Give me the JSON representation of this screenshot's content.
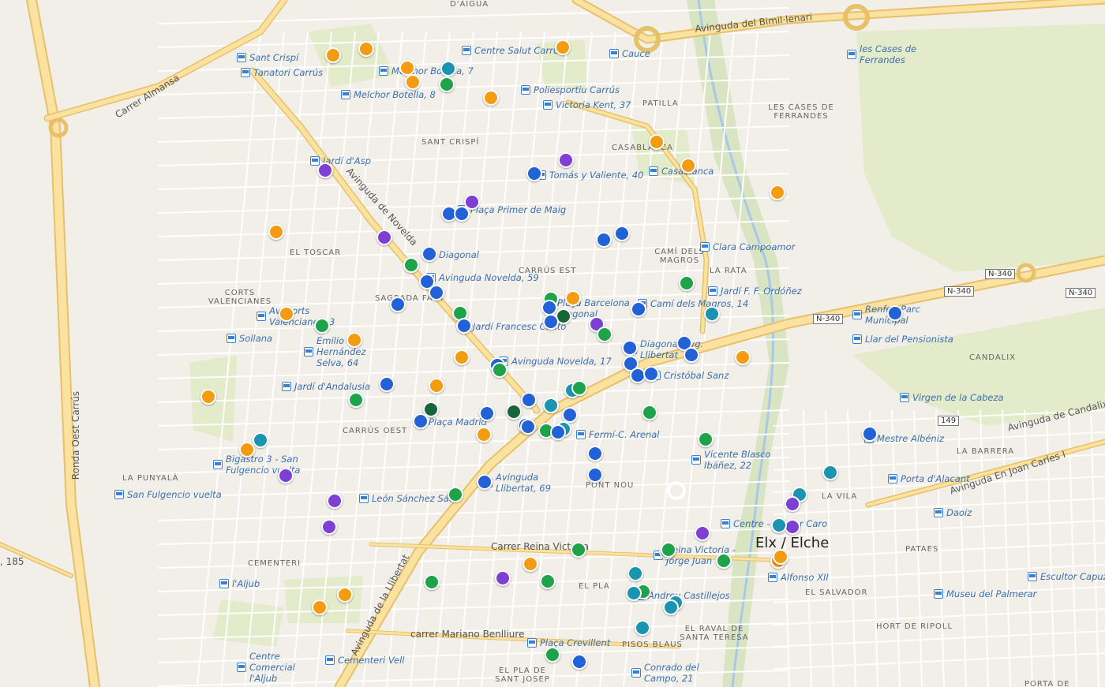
{
  "map": {
    "place_name": "Elx / Elche",
    "colors": {
      "land": "#f2efe9",
      "park": "#e3ebcb",
      "major_road": "#fbe2a0",
      "major_road_edge": "#e7c16a",
      "minor_road": "#ffffff",
      "water": "#a8c8e8",
      "orange": "#f39c12",
      "blue": "#2262d6",
      "purple": "#7e3fd4",
      "green": "#1fa34a",
      "dark_green": "#17663a",
      "teal": "#1a94b0"
    },
    "street_labels": [
      {
        "id": "carrer-almansa",
        "text": "Carrer Almansa"
      },
      {
        "id": "avinguda-novelda",
        "text": "Avinguda de Novelda"
      },
      {
        "id": "ronda-oest-carrus",
        "text": "Ronda Oest Carrús"
      },
      {
        "id": "avinguda-llibertat",
        "text": "Avinguda de la Llibertat"
      },
      {
        "id": "carrer-reina-victoria",
        "text": "Carrer Reina Victoria"
      },
      {
        "id": "carrer-mariano-benlliure",
        "text": "carrer Mariano Benlliure"
      },
      {
        "id": "avinguda-bimil-lenari",
        "text": "Avinguda del Bimil·lenari"
      },
      {
        "id": "avinguda-candalix",
        "text": "Avinguda de Candalix"
      },
      {
        "id": "avinguda-joan-carles",
        "text": "Avinguda En Joan Carles I"
      },
      {
        "id": "road-185",
        "text": ", 185"
      }
    ],
    "districts": [
      {
        "id": "d-aigua",
        "text": "D'AIGUA"
      },
      {
        "id": "sant-crispi",
        "text": "SANT CRISPÍ"
      },
      {
        "id": "patilla",
        "text": "PATILLA"
      },
      {
        "id": "les-cases",
        "text": "LES CASES DE FERRANDES"
      },
      {
        "id": "casablanca",
        "text": "CASABLANCA"
      },
      {
        "id": "el-toscar",
        "text": "EL TOSCAR"
      },
      {
        "id": "cami-magros",
        "text": "CAMÍ DELS MAGROS"
      },
      {
        "id": "la-rata",
        "text": "LA RATA"
      },
      {
        "id": "carrus-est",
        "text": "CARRÚS EST"
      },
      {
        "id": "corts-valencianes",
        "text": "CORTS VALENCIANES"
      },
      {
        "id": "sagrada-familia",
        "text": "SAGRADA FAMÍ"
      },
      {
        "id": "carrus-oest",
        "text": "CARRÚS OEST"
      },
      {
        "id": "la-punyala",
        "text": "LA PUNYALÀ"
      },
      {
        "id": "cementeri",
        "text": "CEMENTERI"
      },
      {
        "id": "candalix",
        "text": "CANDALIX"
      },
      {
        "id": "la-barrera",
        "text": "LA BARRERA"
      },
      {
        "id": "la-vila",
        "text": "LA VILA"
      },
      {
        "id": "pont-nou",
        "text": "PONT NOU"
      },
      {
        "id": "el-pla",
        "text": "EL PLA"
      },
      {
        "id": "pisos-blaus",
        "text": "PISOS BLAUS"
      },
      {
        "id": "raval",
        "text": "EL RAVAL DE SANTA TERESA"
      },
      {
        "id": "el-salvador",
        "text": "EL SALVADOR"
      },
      {
        "id": "hort-de-ripoll",
        "text": "HORT DE RIPOLL"
      },
      {
        "id": "pataes",
        "text": "PATAES"
      },
      {
        "id": "el-pla-sant-josep",
        "text": "EL PLA DE SANT JOSEP"
      },
      {
        "id": "porta-de",
        "text": "PORTA DE"
      }
    ],
    "shields": [
      {
        "id": "n340-a",
        "text": "N-340"
      },
      {
        "id": "n340-b",
        "text": "N-340"
      },
      {
        "id": "n340-c",
        "text": "N-340"
      },
      {
        "id": "n340-d",
        "text": "N-340"
      },
      {
        "id": "r149",
        "text": "149"
      }
    ],
    "bus_stops": [
      {
        "id": "sant-crispi",
        "text": "Sant Crispí"
      },
      {
        "id": "tanatori-carrus",
        "text": "Tanatori Carrús"
      },
      {
        "id": "melchor-botella-7",
        "text": "Melchor Botella, 7"
      },
      {
        "id": "melchor-botella-8",
        "text": "Melchor Botella, 8"
      },
      {
        "id": "centre-salut-carrus",
        "text": "Centre Salut Carrús"
      },
      {
        "id": "cauce",
        "text": "Cauce"
      },
      {
        "id": "les-cases-ferrandes",
        "text": "les Cases de Ferrandes"
      },
      {
        "id": "poliesportiu-carrus",
        "text": "Poliesportiu Carrús"
      },
      {
        "id": "victoria-kent",
        "text": "Victoria Kent, 37"
      },
      {
        "id": "jardi-asp",
        "text": "Jardí d'Asp"
      },
      {
        "id": "tomas-valiente",
        "text": "Tomás y Valiente, 40"
      },
      {
        "id": "casablanca",
        "text": "Casablanca"
      },
      {
        "id": "placa-primer-maig",
        "text": "Plaça Primer de Maig"
      },
      {
        "id": "clara-campoamor",
        "text": "Clara Campoamor"
      },
      {
        "id": "diagonal",
        "text": "Diagonal"
      },
      {
        "id": "avinguda-novelda-59",
        "text": "Avinguda Novelda, 59"
      },
      {
        "id": "jardi-ordonez",
        "text": "Jardí F. F. Ordóñez"
      },
      {
        "id": "placa-barcelona",
        "text": "Plaça Barcelona Diagonal"
      },
      {
        "id": "cami-magros-14",
        "text": "Camí dels Magros, 14"
      },
      {
        "id": "renfe-parc",
        "text": "Renfe - Parc Municipal"
      },
      {
        "id": "avcorts",
        "text": "Av. Corts Valencianes, 3"
      },
      {
        "id": "jardi-francesc",
        "text": "Jardí Francesc Cantó"
      },
      {
        "id": "llar-pensionista",
        "text": "Llar del Pensionista"
      },
      {
        "id": "emilio-hernandez",
        "text": "Emilio Hernández Selva, 64"
      },
      {
        "id": "sollana",
        "text": "Sollana"
      },
      {
        "id": "diagonal-libertat",
        "text": "Diagonal Avg. Llibertat"
      },
      {
        "id": "avinguda-novelda-17",
        "text": "Avinguda Novelda, 17"
      },
      {
        "id": "cristobal-sanz",
        "text": "Cristóbal Sanz"
      },
      {
        "id": "jardi-andalusia",
        "text": "Jardí d'Andalusia"
      },
      {
        "id": "virgen-cabeza",
        "text": "Virgen de la Cabeza"
      },
      {
        "id": "placa-madrid",
        "text": "Plaça Madrid"
      },
      {
        "id": "fermi-arenal",
        "text": "Fermí-C. Arenal"
      },
      {
        "id": "mestre-albeniz",
        "text": "Mestre Albéniz"
      },
      {
        "id": "vicente-blasco",
        "text": "Vicente Blasco Ibáñez, 22"
      },
      {
        "id": "bigastro",
        "text": "Bigastro 3 - San Fulgencio vuelta"
      },
      {
        "id": "porta-alacant",
        "text": "Porta d'Alacant"
      },
      {
        "id": "avinguda-llibertat-69",
        "text": "Avinguda Llibertat, 69"
      },
      {
        "id": "san-fulgencio",
        "text": "San Fulgencio vuelta"
      },
      {
        "id": "leon-sanchez",
        "text": "León Sánchez Sáez"
      },
      {
        "id": "daoiz",
        "text": "Daoiz"
      },
      {
        "id": "centre-faro",
        "text": "Centre - Doctor Caro"
      },
      {
        "id": "reina-victoria-jorge",
        "text": "Reina Victoria - Jorge Juan"
      },
      {
        "id": "alfonso-xii",
        "text": "Alfonso XII"
      },
      {
        "id": "escultor-capuz",
        "text": "Escultor Capuz"
      },
      {
        "id": "aljub",
        "text": "l'Aljub"
      },
      {
        "id": "andreu-castillejos",
        "text": "Andreu Castillejos"
      },
      {
        "id": "museu-palmerar",
        "text": "Museu del Palmerar"
      },
      {
        "id": "centre-comercial",
        "text": "Centre Comercial l'Aljub"
      },
      {
        "id": "cementeri-vell",
        "text": "Cementeri Vell"
      },
      {
        "id": "placa-crevillent",
        "text": "Plaça Crevillent"
      },
      {
        "id": "conrado-campo",
        "text": "Conrado del Campo, 21"
      }
    ],
    "markers": [
      {
        "c": "orange"
      },
      {
        "c": "orange"
      },
      {
        "c": "orange"
      },
      {
        "c": "teal"
      },
      {
        "c": "orange"
      },
      {
        "c": "green"
      },
      {
        "c": "orange"
      },
      {
        "c": "orange"
      },
      {
        "c": "purple"
      },
      {
        "c": "purple"
      },
      {
        "c": "blue"
      },
      {
        "c": "orange"
      },
      {
        "c": "orange"
      },
      {
        "c": "orange"
      },
      {
        "c": "purple"
      },
      {
        "c": "blue"
      },
      {
        "c": "blue"
      },
      {
        "c": "orange"
      },
      {
        "c": "purple"
      },
      {
        "c": "blue"
      },
      {
        "c": "blue"
      },
      {
        "c": "blue"
      },
      {
        "c": "green"
      },
      {
        "c": "blue"
      },
      {
        "c": "blue"
      },
      {
        "c": "green"
      },
      {
        "c": "orange"
      },
      {
        "c": "blue"
      },
      {
        "c": "green"
      },
      {
        "c": "blue"
      },
      {
        "c": "green"
      },
      {
        "c": "orange"
      },
      {
        "c": "blue"
      },
      {
        "c": "dark_green"
      },
      {
        "c": "blue"
      },
      {
        "c": "orange"
      },
      {
        "c": "green"
      },
      {
        "c": "blue"
      },
      {
        "c": "purple"
      },
      {
        "c": "green"
      },
      {
        "c": "teal"
      },
      {
        "c": "orange"
      },
      {
        "c": "orange"
      },
      {
        "c": "blue"
      },
      {
        "c": "blue"
      },
      {
        "c": "blue"
      },
      {
        "c": "blue"
      },
      {
        "c": "blue"
      },
      {
        "c": "blue"
      },
      {
        "c": "orange"
      },
      {
        "c": "blue"
      },
      {
        "c": "green"
      },
      {
        "c": "orange"
      },
      {
        "c": "green"
      },
      {
        "c": "teal"
      },
      {
        "c": "green"
      },
      {
        "c": "blue"
      },
      {
        "c": "blue"
      },
      {
        "c": "teal"
      },
      {
        "c": "dark_green"
      },
      {
        "c": "blue"
      },
      {
        "c": "dark_green"
      },
      {
        "c": "blue"
      },
      {
        "c": "blue"
      },
      {
        "c": "blue"
      },
      {
        "c": "blue"
      },
      {
        "c": "green"
      },
      {
        "c": "orange"
      },
      {
        "c": "teal"
      },
      {
        "c": "green"
      },
      {
        "c": "teal"
      },
      {
        "c": "blue"
      },
      {
        "c": "blue"
      },
      {
        "c": "blue"
      },
      {
        "c": "green"
      },
      {
        "c": "green"
      },
      {
        "c": "orange"
      },
      {
        "c": "teal"
      },
      {
        "c": "blue"
      },
      {
        "c": "blue"
      },
      {
        "c": "blue"
      },
      {
        "c": "orange"
      },
      {
        "c": "teal"
      },
      {
        "c": "purple"
      },
      {
        "c": "purple"
      },
      {
        "c": "purple"
      },
      {
        "c": "green"
      },
      {
        "c": "teal"
      },
      {
        "c": "teal"
      },
      {
        "c": "purple"
      },
      {
        "c": "teal"
      },
      {
        "c": "purple"
      },
      {
        "c": "purple"
      },
      {
        "c": "green"
      },
      {
        "c": "green"
      },
      {
        "c": "orange"
      },
      {
        "c": "teal"
      },
      {
        "c": "green"
      },
      {
        "c": "purple"
      },
      {
        "c": "green"
      },
      {
        "c": "green"
      },
      {
        "c": "orange"
      },
      {
        "c": "orange"
      },
      {
        "c": "orange"
      },
      {
        "c": "green"
      },
      {
        "c": "teal"
      },
      {
        "c": "teal"
      },
      {
        "c": "green"
      },
      {
        "c": "blue"
      },
      {
        "c": "green"
      }
    ]
  }
}
